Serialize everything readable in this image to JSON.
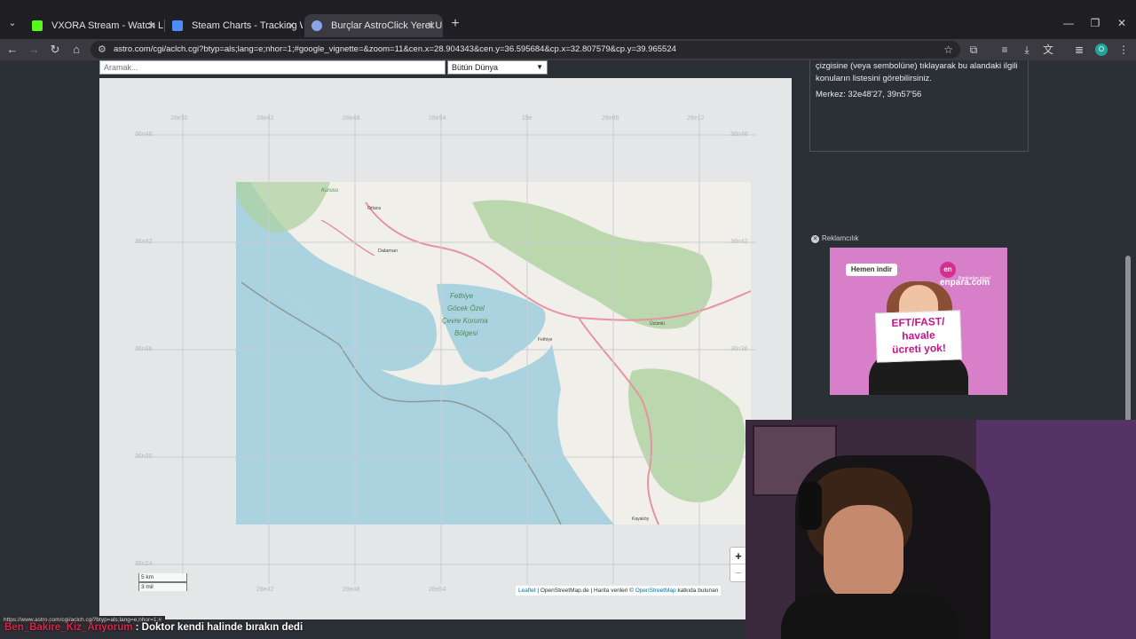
{
  "tabs": [
    {
      "title": "VXORA Stream - Watch Live",
      "favicon_color": "#53fc18",
      "active": false
    },
    {
      "title": "Steam Charts - Tracking What's",
      "favicon_color": "#4c8dff",
      "active": false
    },
    {
      "title": "Burçlar AstroClick Yerel Uzay",
      "favicon_color": "#8aa4e8",
      "active": true
    }
  ],
  "address_bar": {
    "url": "astro.com/cgi/aclch.cgi?btyp=als;lang=e;nhor=1;#google_vignette=&zoom=11&cen.x=28.904343&cen.y=36.595684&cp.x=32.807579&cp.y=39.965524"
  },
  "profile": {
    "initial": "O"
  },
  "page": {
    "search_placeholder": "Aramak...",
    "region_select": "Bütün Dünya",
    "info_text_1": "çizgisine (veya sembolüne) tıklayarak bu alandaki ilgili",
    "info_text_2": "konuların listesini görebilirsiniz.",
    "info_center": "Merkez: 32e48'27, 39n57'56",
    "ad_label": "Reklamcılık",
    "ad": {
      "button": "Hemen indir",
      "logo": "enpara.com",
      "logo_sub": "Bankadan güzel",
      "line1": "EFT/FAST/",
      "line2": "havale",
      "line3": "ücreti yok!"
    }
  },
  "map": {
    "zoom_in": "+",
    "zoom_out": "−",
    "scale_km": "5 km",
    "scale_mi": "3 mil",
    "attribution_leaflet": "Leaflet",
    "attribution_rest": " | OpenStreetMap.de | Harita verileri © ",
    "attribution_osm": "OpenStreetMap",
    "attribution_tail": " katkıda bulunan",
    "top_labels": [
      "28e30",
      "28e42",
      "28e48",
      "28e54",
      "29e",
      "29e06",
      "29e12"
    ],
    "bottom_labels": [
      "28e42",
      "28e48",
      "28e54"
    ],
    "left_labels": [
      "36n48",
      "36n42",
      "36n36",
      "36n30",
      "36n24"
    ],
    "right_labels": [
      "36n48",
      "36n42",
      "36n36"
    ],
    "place_labels": {
      "gulf": "Fethiye Göcek Özel Çevre Koruma Bölgesi",
      "fethiye": "Fethiye",
      "dalaman": "Dalaman",
      "ortaca": "Ortaca",
      "kurusu": "Kurusu Bölgesi",
      "uzumlu": "Üzümlü",
      "kaya": "Kayaköy"
    }
  },
  "status_url": "https://www.astro.com/cgi/aclch.cgi?btyp=als;lang=e;nhor=1;#",
  "chat": {
    "user": "Ben_Bakire_Kiz_Arıyorum",
    "message": " : Doktor kendi halinde bırakın dedi"
  }
}
